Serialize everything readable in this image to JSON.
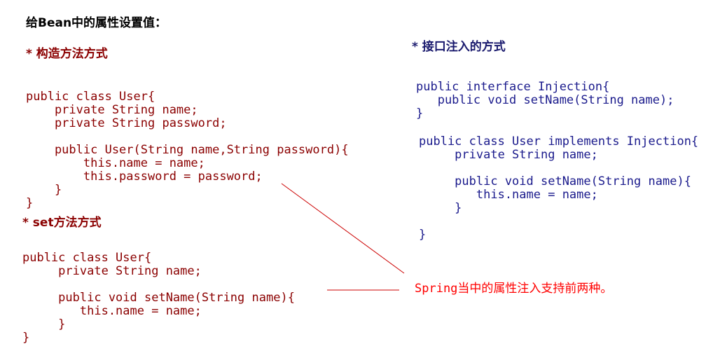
{
  "title": "给Bean中的属性设置值：",
  "sections": {
    "constructor": {
      "heading": "* 构造方法方式",
      "code": [
        "public class User{",
        "    private String name;",
        "    private String password;",
        "",
        "    public User(String name,String password){",
        "        this.name = name;",
        "        this.password = password;",
        "    }",
        "}"
      ]
    },
    "setter": {
      "heading": "* set方法方式",
      "code": [
        "public class User{",
        "     private String name;",
        "",
        "     public void setName(String name){",
        "        this.name = name;",
        "     }",
        "}"
      ]
    },
    "interface": {
      "heading": "* 接口注入的方式",
      "code1": [
        "public interface Injection{",
        "   public void setName(String name);",
        "}"
      ],
      "code2": [
        "public class User implements Injection{",
        "     private String name;",
        "",
        "     public void setName(String name){",
        "        this.name = name;",
        "     }",
        "",
        "}"
      ]
    }
  },
  "note": "Spring当中的属性注入支持前两种。",
  "colors": {
    "code_red": "#8b0000",
    "code_blue": "#1a1a8c",
    "note": "#ff0000"
  }
}
